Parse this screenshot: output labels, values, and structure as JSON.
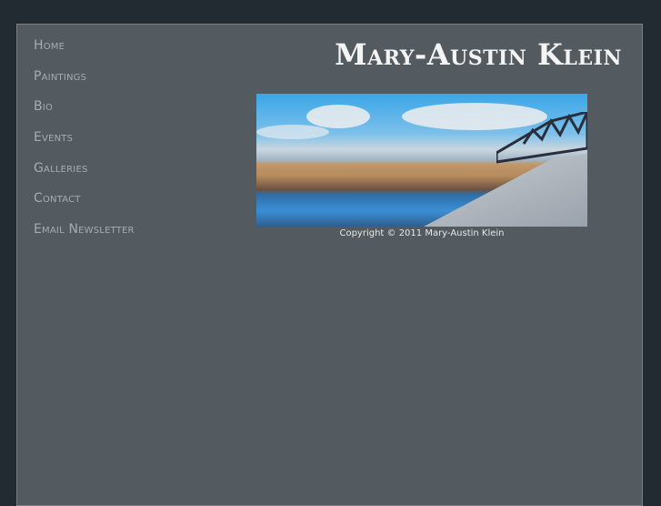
{
  "nav": {
    "items": [
      {
        "label": "Home"
      },
      {
        "label": "Paintings"
      },
      {
        "label": "Bio"
      },
      {
        "label": "Events"
      },
      {
        "label": "Galleries"
      },
      {
        "label": "Contact"
      },
      {
        "label": "Email Newsletter"
      }
    ]
  },
  "header": {
    "title": "Mary-Austin Klein"
  },
  "featured": {
    "caption": "Copyright © 2011 Mary-Austin Klein"
  }
}
